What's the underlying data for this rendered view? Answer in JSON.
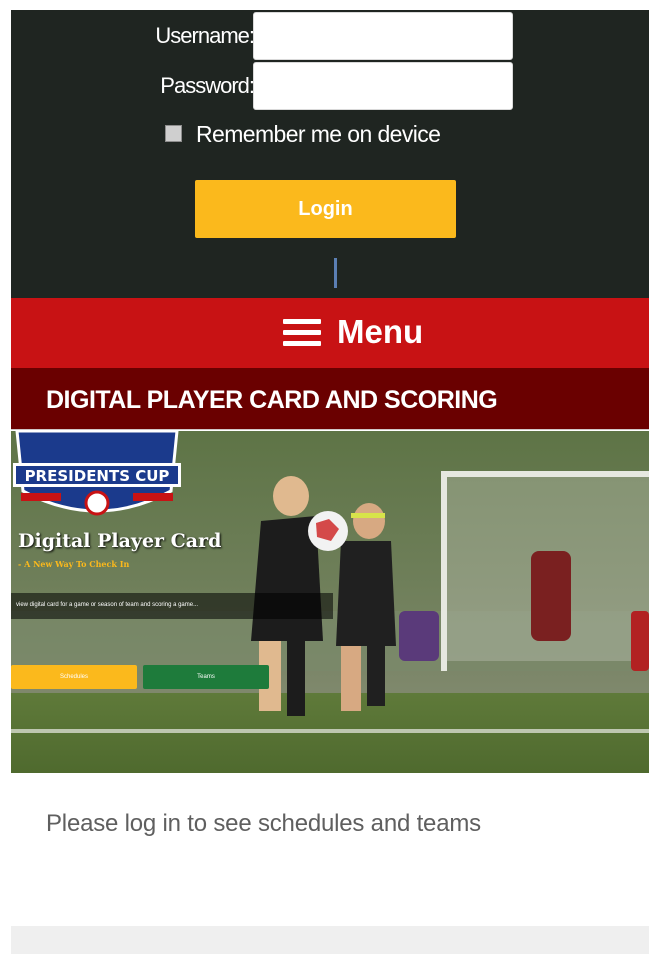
{
  "login": {
    "username_label": "Username:",
    "username_value": "",
    "password_label": "Password:",
    "password_value": "",
    "remember_label": "Remember me on device",
    "login_button": "Login"
  },
  "menu": {
    "label": "Menu"
  },
  "section": {
    "title": "DIGITAL PLAYER CARD AND SCORING"
  },
  "hero": {
    "badge_text": "PRESIDENTS CUP",
    "title": "Digital Player Card",
    "subtitle": "- A New Way To Check In",
    "caption": "view digital card for a game or season of team and scoring a game...",
    "schedules_button": "Schedules",
    "teams_button": "Teams"
  },
  "prompt": "Please log in to see schedules and teams",
  "colors": {
    "panel": "#1f2521",
    "accent": "#fbb91c",
    "menu": "#c81214",
    "section": "#6a0000",
    "teams": "#1e7b3b"
  }
}
